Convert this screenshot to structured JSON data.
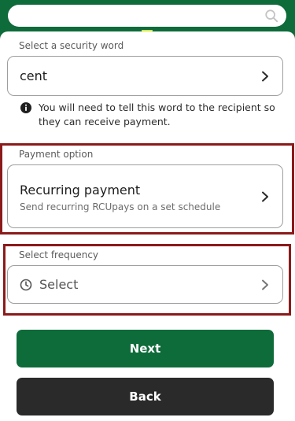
{
  "header": {
    "search_placeholder": "",
    "icons": {
      "search": "search-icon"
    },
    "colors": {
      "brand": "#0e6b3a",
      "accent": "#d7e84a"
    }
  },
  "security_word": {
    "label": "Select a security word",
    "value": "cent",
    "info": "You will need to tell this word to the recipient so they can receive payment.",
    "icons": {
      "info": "info-icon",
      "chevron": "chevron-right-icon"
    }
  },
  "payment_option": {
    "label": "Payment option",
    "title": "Recurring payment",
    "subtitle": "Send recurring RCUpays on a set schedule",
    "icons": {
      "chevron": "chevron-right-icon"
    },
    "highlight_color": "#8b1a1a"
  },
  "frequency": {
    "label": "Select frequency",
    "placeholder": "Select",
    "icons": {
      "clock": "clock-icon",
      "chevron": "chevron-right-icon"
    },
    "highlight_color": "#8b1a1a"
  },
  "actions": {
    "next_label": "Next",
    "back_label": "Back",
    "colors": {
      "next": "#0e6b3a",
      "back": "#2a2a2a"
    }
  }
}
